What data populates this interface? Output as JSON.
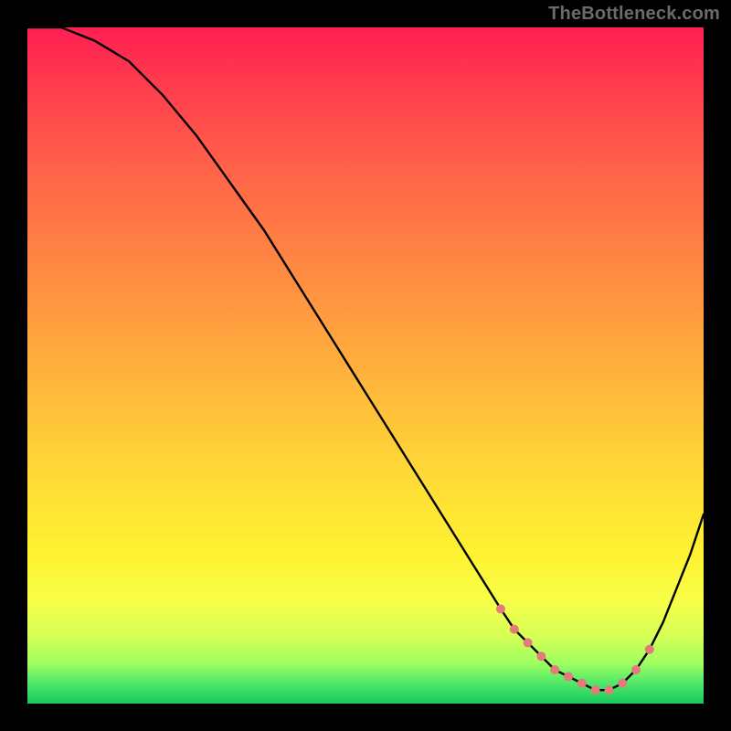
{
  "watermark": "TheBottleneck.com",
  "colors": {
    "curve": "#000000",
    "marker": "#e47a7a"
  },
  "chart_data": {
    "type": "line",
    "title": "",
    "xlabel": "",
    "ylabel": "",
    "xlim": [
      0,
      100
    ],
    "ylim": [
      0,
      100
    ],
    "note": "Axis not shown; y is percentage-of-bottleneck mapped to a vertical color gradient (red≈100, green≈0). Curve values read from vertical positions.",
    "x": [
      0,
      5,
      10,
      15,
      20,
      25,
      30,
      35,
      40,
      45,
      50,
      55,
      60,
      65,
      70,
      72,
      74,
      76,
      78,
      80,
      82,
      84,
      86,
      88,
      90,
      92,
      94,
      96,
      98,
      100
    ],
    "values": [
      100,
      100,
      98,
      95,
      90,
      84,
      77,
      70,
      62,
      54,
      46,
      38,
      30,
      22,
      14,
      11,
      9,
      7,
      5,
      4,
      3,
      2,
      2,
      3,
      5,
      8,
      12,
      17,
      22,
      28
    ],
    "markers_x": [
      70,
      72,
      74,
      76,
      78,
      80,
      82,
      84,
      86,
      88,
      90,
      92
    ]
  }
}
